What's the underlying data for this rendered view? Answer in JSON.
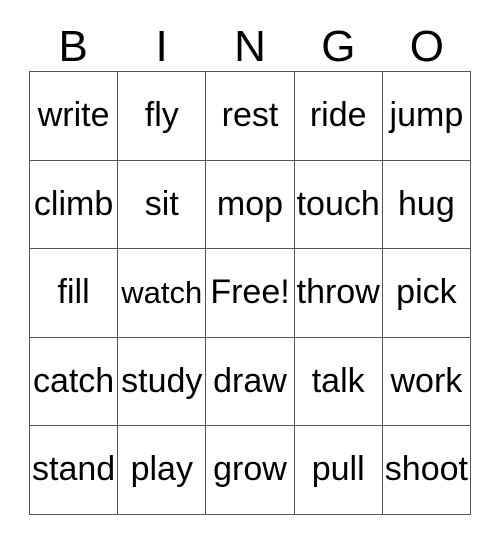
{
  "card": {
    "title": "BINGO",
    "header_letters": [
      "B",
      "I",
      "N",
      "G",
      "O"
    ],
    "free_space_label": "Free!",
    "colors": {
      "background": "#ffffff",
      "border": "#555555",
      "text": "#000000"
    },
    "rows": [
      {
        "cells": [
          {
            "text": "write"
          },
          {
            "text": "fly"
          },
          {
            "text": "rest"
          },
          {
            "text": "ride"
          },
          {
            "text": "jump"
          }
        ]
      },
      {
        "cells": [
          {
            "text": "climb"
          },
          {
            "text": "sit"
          },
          {
            "text": "mop"
          },
          {
            "text": "touch"
          },
          {
            "text": "hug"
          }
        ]
      },
      {
        "cells": [
          {
            "text": "fill"
          },
          {
            "text": "watch"
          },
          {
            "text": "Free!"
          },
          {
            "text": "throw"
          },
          {
            "text": "pick"
          }
        ]
      },
      {
        "cells": [
          {
            "text": "catch"
          },
          {
            "text": "study"
          },
          {
            "text": "draw"
          },
          {
            "text": "talk"
          },
          {
            "text": "work"
          }
        ]
      },
      {
        "cells": [
          {
            "text": "stand"
          },
          {
            "text": "play"
          },
          {
            "text": "grow"
          },
          {
            "text": "pull"
          },
          {
            "text": "shoot"
          }
        ]
      }
    ]
  }
}
